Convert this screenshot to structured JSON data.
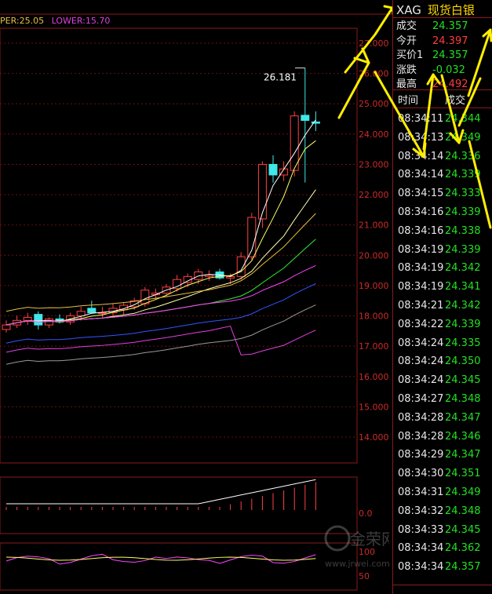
{
  "legend": {
    "upper": "PER:25.05",
    "lower": "LOWER:15.70"
  },
  "panel": {
    "symbol": "XAG",
    "name": "现货白银",
    "quote": [
      {
        "label": "成交",
        "value": "24.357",
        "color": "#22e022"
      },
      {
        "label": "今开",
        "value": "24.397",
        "color": "#ff3b3b"
      },
      {
        "label": "买价1",
        "value": "24.357",
        "color": "#22e022"
      },
      {
        "label": "涨跌",
        "value": "-0.032",
        "color": "#22e022"
      },
      {
        "label": "最高",
        "value": "24.492",
        "color": "#ff3b3b"
      }
    ],
    "col_time": "时间",
    "col_deal": "成交",
    "trades": [
      {
        "time": "08:34:11",
        "price": "24.344"
      },
      {
        "time": "08:34:13",
        "price": "24.349"
      },
      {
        "time": "08:34:14",
        "price": "24.336"
      },
      {
        "time": "08:34:14",
        "price": "24.339"
      },
      {
        "time": "08:34:15",
        "price": "24.333"
      },
      {
        "time": "08:34:16",
        "price": "24.339"
      },
      {
        "time": "08:34:16",
        "price": "24.338"
      },
      {
        "time": "08:34:19",
        "price": "24.339"
      },
      {
        "time": "08:34:19",
        "price": "24.342"
      },
      {
        "time": "08:34:19",
        "price": "24.341"
      },
      {
        "time": "08:34:21",
        "price": "24.342"
      },
      {
        "time": "08:34:22",
        "price": "24.339"
      },
      {
        "time": "08:34:24",
        "price": "24.335"
      },
      {
        "time": "08:34:24",
        "price": "24.350"
      },
      {
        "time": "08:34:24",
        "price": "24.345"
      },
      {
        "time": "08:34:27",
        "price": "24.348"
      },
      {
        "time": "08:34:28",
        "price": "24.347"
      },
      {
        "time": "08:34:28",
        "price": "24.346"
      },
      {
        "time": "08:34:29",
        "price": "24.347"
      },
      {
        "time": "08:34:30",
        "price": "24.351"
      },
      {
        "time": "08:34:31",
        "price": "24.349"
      },
      {
        "time": "08:34:32",
        "price": "24.348"
      },
      {
        "time": "08:34:33",
        "price": "24.345"
      },
      {
        "time": "08:34:34",
        "price": "24.362"
      },
      {
        "time": "08:34:34",
        "price": "24.357"
      }
    ]
  },
  "watermark": {
    "brand": "金荣网",
    "url": "www.jrwei.com"
  },
  "chart_data": {
    "type": "candlestick",
    "price_axis": {
      "min": 14.0,
      "max": 27.0,
      "ticks": [
        27.0,
        26.0,
        25.0,
        24.0,
        23.0,
        22.0,
        21.0,
        20.0,
        19.0,
        18.0,
        17.0,
        16.0,
        15.0,
        14.0
      ]
    },
    "high_annotation": "26.181",
    "candles": [
      {
        "o": 17.55,
        "h": 17.85,
        "l": 17.45,
        "c": 17.7
      },
      {
        "o": 17.7,
        "h": 18.0,
        "l": 17.6,
        "c": 17.85
      },
      {
        "o": 17.85,
        "h": 18.1,
        "l": 17.7,
        "c": 17.95
      },
      {
        "o": 18.05,
        "h": 18.15,
        "l": 17.55,
        "c": 17.7
      },
      {
        "o": 17.7,
        "h": 17.95,
        "l": 17.6,
        "c": 17.9
      },
      {
        "o": 17.9,
        "h": 18.05,
        "l": 17.75,
        "c": 17.8
      },
      {
        "o": 17.8,
        "h": 18.1,
        "l": 17.7,
        "c": 18.0
      },
      {
        "o": 18.0,
        "h": 18.3,
        "l": 17.85,
        "c": 18.15
      },
      {
        "o": 18.25,
        "h": 18.5,
        "l": 18.1,
        "c": 18.1
      },
      {
        "o": 18.1,
        "h": 18.3,
        "l": 17.95,
        "c": 18.1
      },
      {
        "o": 18.1,
        "h": 18.4,
        "l": 17.95,
        "c": 18.25
      },
      {
        "o": 18.2,
        "h": 18.45,
        "l": 18.05,
        "c": 18.35
      },
      {
        "o": 18.3,
        "h": 18.6,
        "l": 18.2,
        "c": 18.5
      },
      {
        "o": 18.4,
        "h": 18.95,
        "l": 18.3,
        "c": 18.85
      },
      {
        "o": 18.7,
        "h": 18.9,
        "l": 18.55,
        "c": 18.75
      },
      {
        "o": 18.75,
        "h": 19.05,
        "l": 18.65,
        "c": 18.95
      },
      {
        "o": 18.9,
        "h": 19.35,
        "l": 18.8,
        "c": 19.2
      },
      {
        "o": 19.1,
        "h": 19.4,
        "l": 18.95,
        "c": 19.3
      },
      {
        "o": 19.2,
        "h": 19.55,
        "l": 19.05,
        "c": 19.45
      },
      {
        "o": 19.3,
        "h": 19.5,
        "l": 19.15,
        "c": 19.35
      },
      {
        "o": 19.45,
        "h": 19.55,
        "l": 19.2,
        "c": 19.25
      },
      {
        "o": 19.25,
        "h": 19.4,
        "l": 19.05,
        "c": 19.3
      },
      {
        "o": 19.3,
        "h": 20.1,
        "l": 19.2,
        "c": 19.95
      },
      {
        "o": 19.95,
        "h": 21.4,
        "l": 19.85,
        "c": 21.25
      },
      {
        "o": 21.2,
        "h": 23.1,
        "l": 20.9,
        "c": 23.0
      },
      {
        "o": 23.0,
        "h": 23.3,
        "l": 22.4,
        "c": 22.65
      },
      {
        "o": 22.65,
        "h": 23.1,
        "l": 22.45,
        "c": 22.85
      },
      {
        "o": 22.8,
        "h": 24.75,
        "l": 22.6,
        "c": 24.6
      },
      {
        "o": 24.62,
        "h": 26.181,
        "l": 22.4,
        "c": 24.45
      },
      {
        "o": 24.4,
        "h": 24.75,
        "l": 24.1,
        "c": 24.357
      }
    ],
    "lower_panels": [
      {
        "axis_label": "0.0",
        "axis_value": 0.0
      },
      {
        "axis_labels": [
          "100",
          "50"
        ],
        "axis_values": [
          100,
          50
        ]
      }
    ]
  }
}
